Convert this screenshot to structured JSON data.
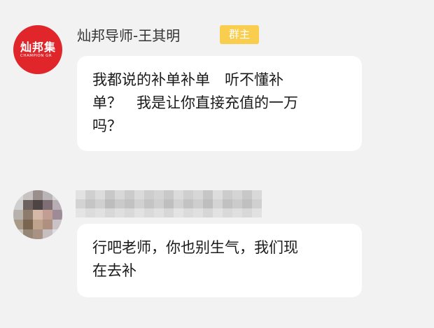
{
  "messages": [
    {
      "sender": "灿邦导师-王其明",
      "badge": "群主",
      "avatar": {
        "type": "logo",
        "text": "灿邦集",
        "subtext": "CHAMPION GR"
      },
      "lines": [
        "我都说的补单补单　听不懂补",
        "单？　我是让你直接充值的一万",
        "吗？"
      ]
    },
    {
      "sender": "",
      "avatar": {
        "type": "pixelated"
      },
      "lines": [
        "行吧老师，你也别生气，我们现",
        "在去补"
      ]
    }
  ],
  "colors": {
    "background": "#f2f2f2",
    "bubble": "#ffffff",
    "badge": "#f9ce4f",
    "logo": "#e0262b"
  }
}
